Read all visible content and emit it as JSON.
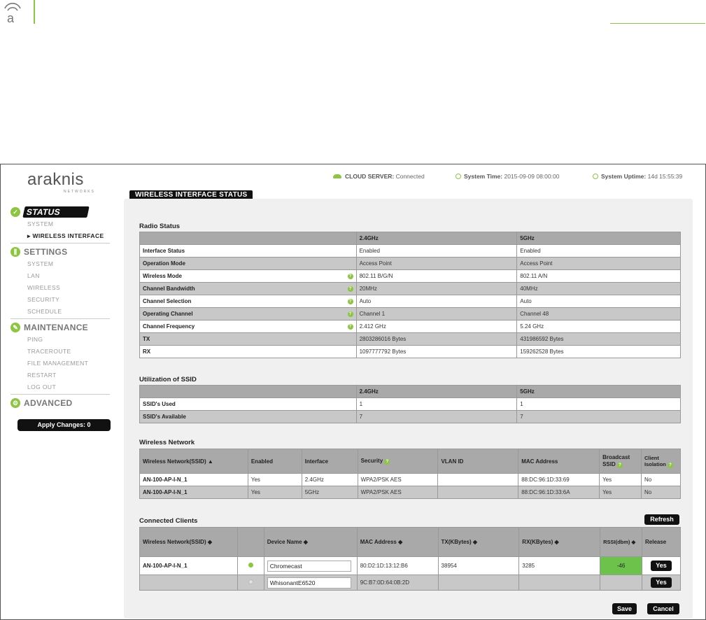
{
  "top": {
    "mark": "a"
  },
  "logo": {
    "name": "araknis",
    "sub": "NETWORKS"
  },
  "topbar": {
    "cloud_label": "CLOUD SERVER:",
    "cloud_value": "Connected",
    "time_label": "System Time:",
    "time_value": "2015-09-09 08:00:00",
    "uptime_label": "System Uptime:",
    "uptime_value": "14d 15:55:39"
  },
  "sidebar": {
    "status": "STATUS",
    "status_items": [
      "SYSTEM",
      "WIRELESS INTERFACE"
    ],
    "settings": "SETTINGS",
    "settings_items": [
      "SYSTEM",
      "LAN",
      "WIRELESS",
      "SECURITY",
      "SCHEDULE"
    ],
    "maintenance": "MAINTENANCE",
    "maintenance_items": [
      "PING",
      "TRACEROUTE",
      "FILE MANAGEMENT",
      "RESTART",
      "LOG OUT"
    ],
    "advanced": "ADVANCED",
    "apply": "Apply Changes: 0"
  },
  "page_tab": "WIRELESS INTERFACE STATUS",
  "radio": {
    "title": "Radio Status",
    "headers": [
      "",
      "2.4GHz",
      "5GHz"
    ],
    "rows": [
      [
        "Interface Status",
        "Enabled",
        "Enabled"
      ],
      [
        "Operation Mode",
        "Access Point",
        "Access Point"
      ],
      [
        "Wireless Mode",
        "802.11 B/G/N",
        "802.11 A/N"
      ],
      [
        "Channel Bandwidth",
        "20MHz",
        "40MHz"
      ],
      [
        "Channel Selection",
        "Auto",
        "Auto"
      ],
      [
        "Operating Channel",
        "Channel 1",
        "Channel 48"
      ],
      [
        "Channel Frequency",
        "2.412 GHz",
        "5.24 GHz"
      ],
      [
        "TX",
        "2803286016 Bytes",
        "431986592 Bytes"
      ],
      [
        "RX",
        "1097777792 Bytes",
        "159262528 Bytes"
      ]
    ]
  },
  "ssid": {
    "title": "Utilization of SSID",
    "headers": [
      "",
      "2.4GHz",
      "5GHz"
    ],
    "rows": [
      [
        "SSID's Used",
        "1",
        "1"
      ],
      [
        "SSID's Available",
        "7",
        "7"
      ]
    ]
  },
  "wnet": {
    "title": "Wireless Network",
    "headers": [
      "Wireless Network(SSID) ▲",
      "Enabled",
      "Interface",
      "Security",
      "VLAN ID",
      "MAC Address",
      "Broadcast SSID",
      "Client Isolation"
    ],
    "rows": [
      [
        "AN-100-AP-I-N_1",
        "Yes",
        "2.4GHz",
        "WPA2/PSK AES",
        "",
        "88:DC:96:1D:33:69",
        "Yes",
        "No"
      ],
      [
        "AN-100-AP-I-N_1",
        "Yes",
        "5GHz",
        "WPA2/PSK AES",
        "",
        "88:DC:96:1D:33:6A",
        "Yes",
        "No"
      ]
    ]
  },
  "clients": {
    "title": "Connected Clients",
    "refresh": "Refresh",
    "headers": [
      "Wireless Network(SSID) ◆",
      "",
      "Device Name ◆",
      "MAC Address ◆",
      "TX(KBytes) ◆",
      "RX(KBytes) ◆",
      "RSSI(dbm) ◆",
      "Release"
    ],
    "rows": [
      {
        "ssid": "AN-100-AP-I-N_1",
        "device": "Chromecast",
        "mac": "80:D2:1D:13:12:B6",
        "tx": "38954",
        "rx": "3285",
        "rssi": "-46",
        "release": "Yes"
      },
      {
        "ssid": "",
        "device": "WhisonantE6520",
        "mac": "9C:B7:0D:64:0B:2D",
        "tx": "",
        "rx": "",
        "rssi": "",
        "release": "Yes"
      }
    ]
  },
  "buttons": {
    "save": "Save",
    "cancel": "Cancel"
  },
  "colors": {
    "accent": "#8cc63f",
    "dark": "#111111",
    "header": "#a9a9a9"
  }
}
